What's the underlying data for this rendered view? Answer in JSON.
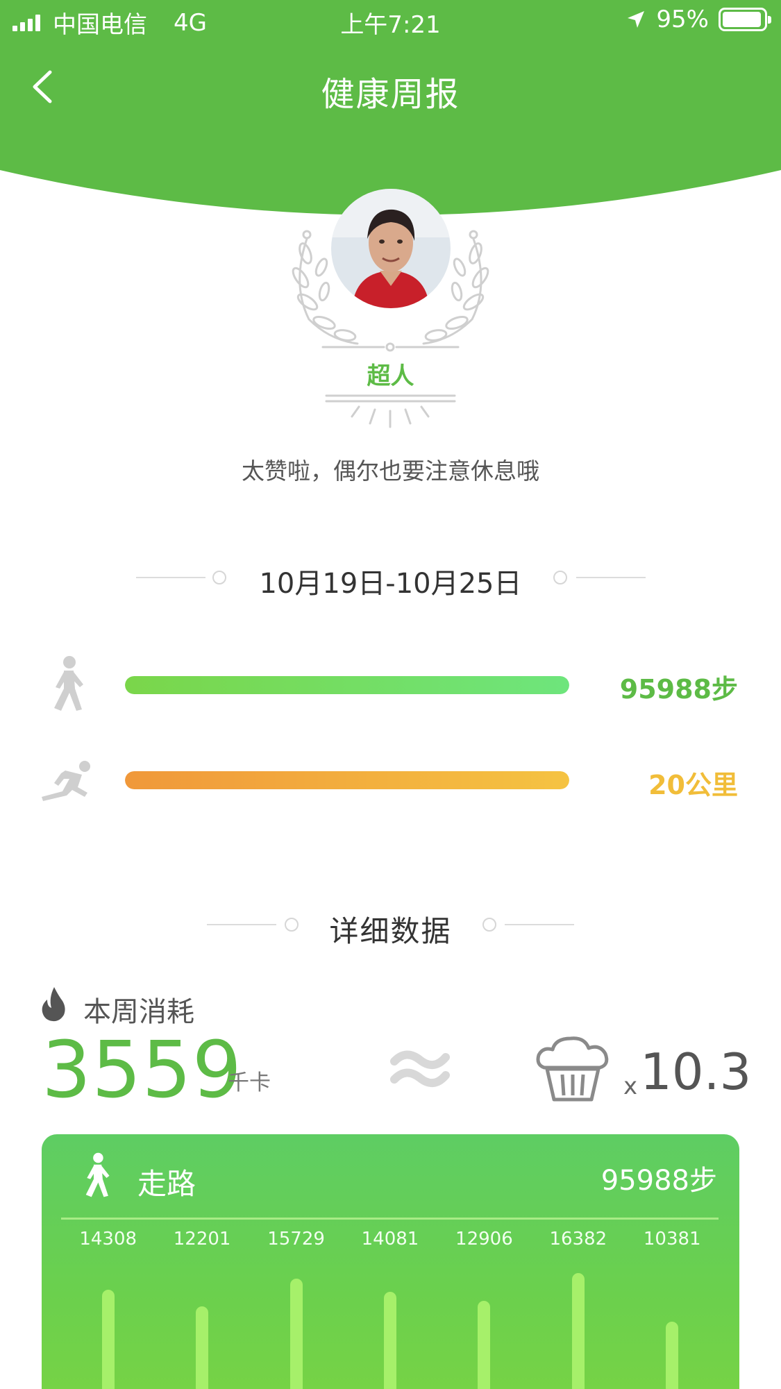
{
  "status_bar": {
    "carrier": "中国电信",
    "network": "4G",
    "time": "上午7:21",
    "battery": "95%"
  },
  "nav": {
    "title": "健康周报"
  },
  "badge": {
    "title": "超人",
    "slogan": "太赞啦，偶尔也要注意休息哦"
  },
  "summary": {
    "date_range": "10月19日-10月25日",
    "steps_value": "95988步",
    "distance_value": "20公里"
  },
  "details": {
    "section_title": "详细数据",
    "calories_label": "本周消耗",
    "calories_value": "3559",
    "calories_unit": "千卡",
    "multiplier_x": "x",
    "multiplier_value": "10.3"
  },
  "walking_card": {
    "label": "走路",
    "total": "95988步",
    "daily_steps": [
      "14308",
      "12201",
      "15729",
      "14081",
      "12906",
      "16382",
      "10381"
    ]
  },
  "colors": {
    "brand_green": "#5dbb46",
    "steps_green": "#5dbb46",
    "distance_yellow": "#f1bd39"
  }
}
